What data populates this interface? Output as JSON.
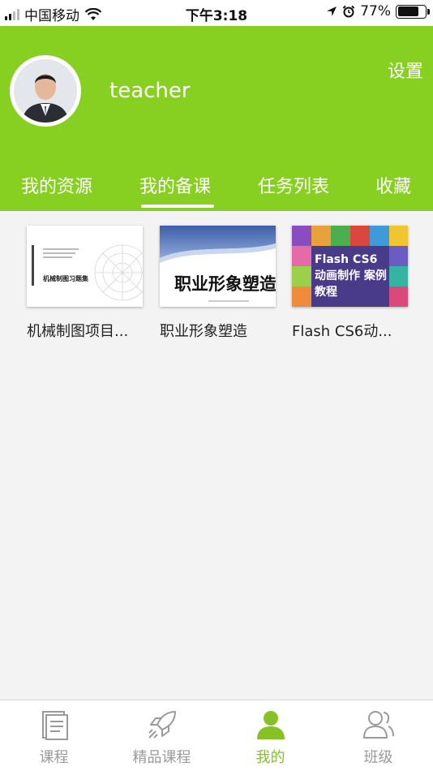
{
  "status_bar": {
    "carrier": "中国移动",
    "time": "下午3:18",
    "battery": "77%",
    "battery_level": 0.77
  },
  "profile": {
    "username": "teacher",
    "settings_label": "设置"
  },
  "tabs": [
    {
      "label": "我的资源"
    },
    {
      "label": "我的备课"
    },
    {
      "label": "任务列表"
    },
    {
      "label": "收藏"
    }
  ],
  "active_tab": 1,
  "resources": [
    {
      "title": "机械制图项目...",
      "cover_text": "机械制图习题集"
    },
    {
      "title": "职业形象塑造",
      "cover_text": "职业形象塑造"
    },
    {
      "title": "Flash CS6动...",
      "cover_text": "Flash CS6 动画制作 案例教程"
    }
  ],
  "tabbar": [
    {
      "label": "课程",
      "icon": "document-icon"
    },
    {
      "label": "精品课程",
      "icon": "rocket-icon"
    },
    {
      "label": "我的",
      "icon": "person-icon"
    },
    {
      "label": "班级",
      "icon": "group-icon"
    }
  ],
  "colors": {
    "accent": "#87d022",
    "active_tab": "#87c225",
    "inactive": "#9a9a9a"
  }
}
